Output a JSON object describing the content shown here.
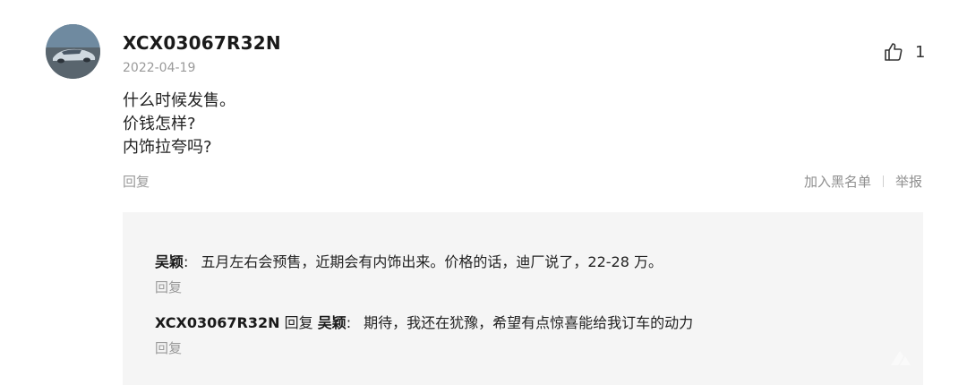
{
  "comment": {
    "username": "XCX03067R32N",
    "date": "2022-04-19",
    "likes": "1",
    "text_lines": [
      "什么时候发售。",
      "价钱怎样?",
      "内饰拉夸吗?"
    ],
    "reply_label": "回复",
    "blacklist_label": "加入黑名单",
    "report_label": "举报",
    "avatar_icon": "car-photo-avatar",
    "like_icon": "thumbs-up-icon"
  },
  "replies": [
    {
      "author": "吴颖",
      "colon": ":",
      "text": "五月左右会预售，近期会有内饰出来。价格的话，迪厂说了，22-28 万。",
      "reply_label": "回复"
    },
    {
      "author": "XCX03067R32N",
      "reply_word": "回复",
      "target": "吴颖",
      "colon": ":",
      "text": "期待，我还在犹豫，希望有点惊喜能给我订车的动力",
      "reply_label": "回复"
    }
  ],
  "colors": {
    "reply_bg": "#f5f5f5",
    "muted_text": "#9a9a9a",
    "main_text": "#222222"
  }
}
